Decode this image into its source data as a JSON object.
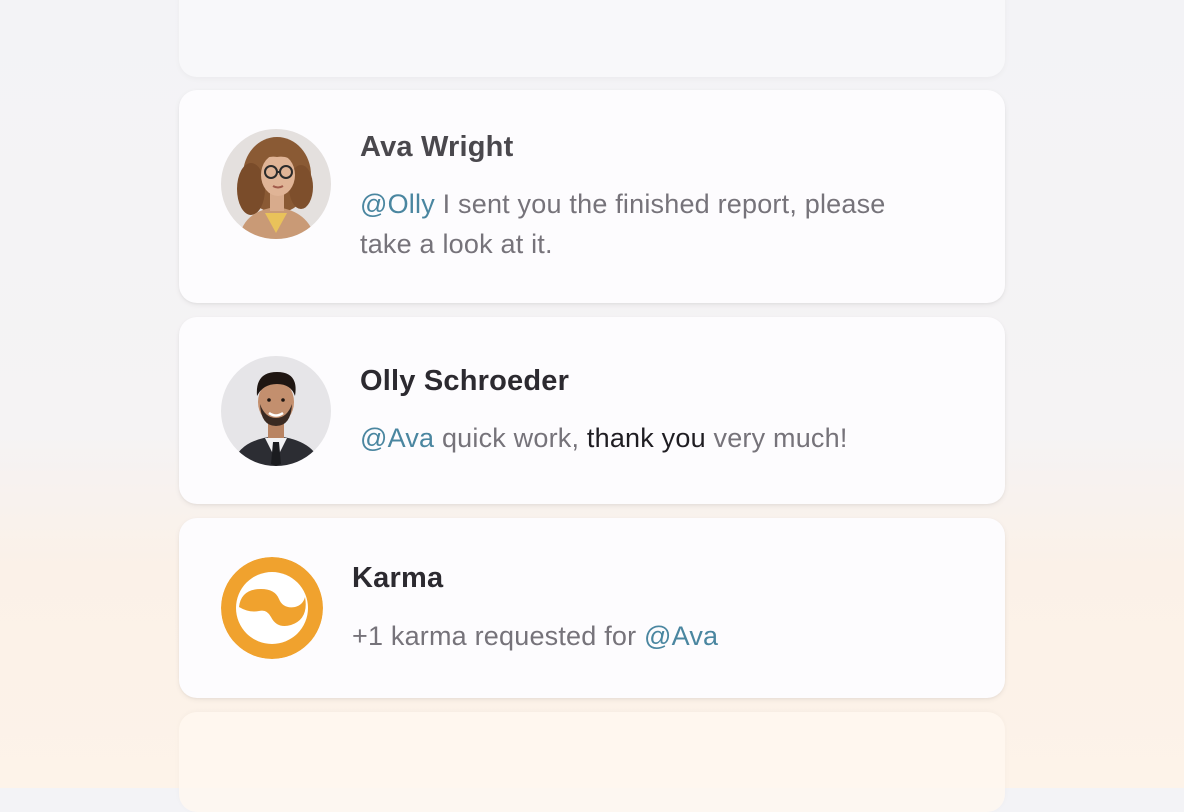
{
  "colors": {
    "mention": "#4a86a0",
    "karma_orange": "#f0a22e",
    "muted_text": "#76737a",
    "name_text": "#2c2a30"
  },
  "messages": [
    {
      "name": "Ava Wright",
      "avatar_icon": "avatar-ava-wright",
      "mention": "@Olly",
      "text_line1": " I sent you the finished report, please",
      "text_line2": "take a look at it."
    },
    {
      "name": "Olly Schroeder",
      "avatar_icon": "avatar-olly-schroeder",
      "mention": "@Ava",
      "text_before": " quick work, ",
      "text_strong": "thank you",
      "text_after": " very much!"
    },
    {
      "name": "Karma",
      "avatar_icon": "karma-logo-icon",
      "text_before": "+1 karma requested for ",
      "mention": "@Ava"
    }
  ]
}
